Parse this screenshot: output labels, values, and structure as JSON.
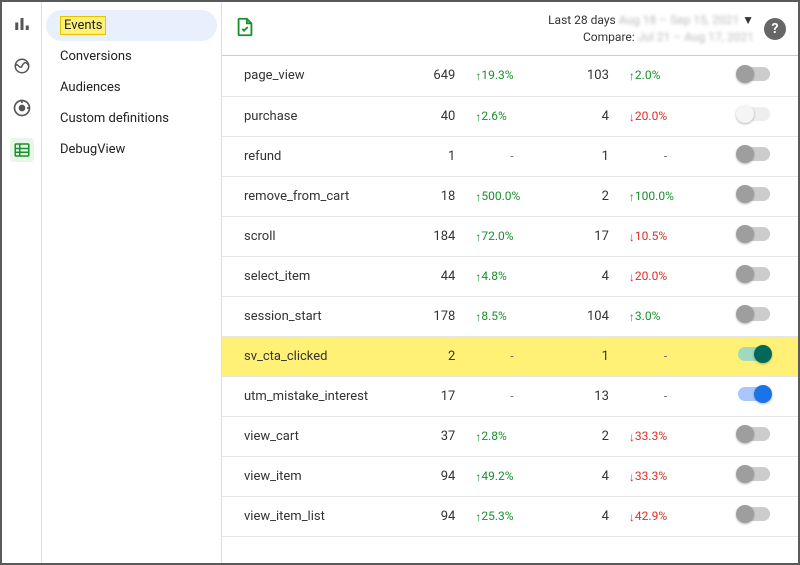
{
  "daterange": {
    "label": "Last 28 days",
    "range_blur": "Aug 18 – Sep 15, 2021",
    "compare_label": "Compare:",
    "compare_blur": "Jul 21 – Aug 17, 2021"
  },
  "secnav": {
    "items": [
      {
        "label": "Events",
        "selected": true,
        "highlight": true
      },
      {
        "label": "Conversions"
      },
      {
        "label": "Audiences"
      },
      {
        "label": "Custom definitions"
      },
      {
        "label": "DebugView"
      }
    ]
  },
  "events": [
    {
      "name": "page_view",
      "count": 649,
      "d1": {
        "dir": "up",
        "pct": "19.3%"
      },
      "users": 103,
      "d2": {
        "dir": "up",
        "pct": "2.0%"
      },
      "toggle": "off"
    },
    {
      "name": "purchase",
      "count": 40,
      "d1": {
        "dir": "up",
        "pct": "2.6%"
      },
      "users": 4,
      "d2": {
        "dir": "down",
        "pct": "20.0%"
      },
      "toggle": "disabled"
    },
    {
      "name": "refund",
      "count": 1,
      "d1": null,
      "users": 1,
      "d2": null,
      "toggle": "off"
    },
    {
      "name": "remove_from_cart",
      "count": 18,
      "d1": {
        "dir": "up",
        "pct": "500.0%"
      },
      "users": 2,
      "d2": {
        "dir": "up",
        "pct": "100.0%"
      },
      "toggle": "off"
    },
    {
      "name": "scroll",
      "count": 184,
      "d1": {
        "dir": "up",
        "pct": "72.0%"
      },
      "users": 17,
      "d2": {
        "dir": "down",
        "pct": "10.5%"
      },
      "toggle": "off"
    },
    {
      "name": "select_item",
      "count": 44,
      "d1": {
        "dir": "up",
        "pct": "4.8%"
      },
      "users": 4,
      "d2": {
        "dir": "down",
        "pct": "20.0%"
      },
      "toggle": "off"
    },
    {
      "name": "session_start",
      "count": 178,
      "d1": {
        "dir": "up",
        "pct": "8.5%"
      },
      "users": 104,
      "d2": {
        "dir": "up",
        "pct": "3.0%"
      },
      "toggle": "off"
    },
    {
      "name": "sv_cta_clicked",
      "count": 2,
      "d1": null,
      "users": 1,
      "d2": null,
      "toggle": "on",
      "highlight": true
    },
    {
      "name": "utm_mistake_interest",
      "count": 17,
      "d1": null,
      "users": 13,
      "d2": null,
      "toggle": "blue"
    },
    {
      "name": "view_cart",
      "count": 37,
      "d1": {
        "dir": "up",
        "pct": "2.8%"
      },
      "users": 2,
      "d2": {
        "dir": "down",
        "pct": "33.3%"
      },
      "toggle": "off"
    },
    {
      "name": "view_item",
      "count": 94,
      "d1": {
        "dir": "up",
        "pct": "49.2%"
      },
      "users": 4,
      "d2": {
        "dir": "down",
        "pct": "33.3%"
      },
      "toggle": "off"
    },
    {
      "name": "view_item_list",
      "count": 94,
      "d1": {
        "dir": "up",
        "pct": "25.3%"
      },
      "users": 4,
      "d2": {
        "dir": "down",
        "pct": "42.9%"
      },
      "toggle": "off"
    }
  ]
}
